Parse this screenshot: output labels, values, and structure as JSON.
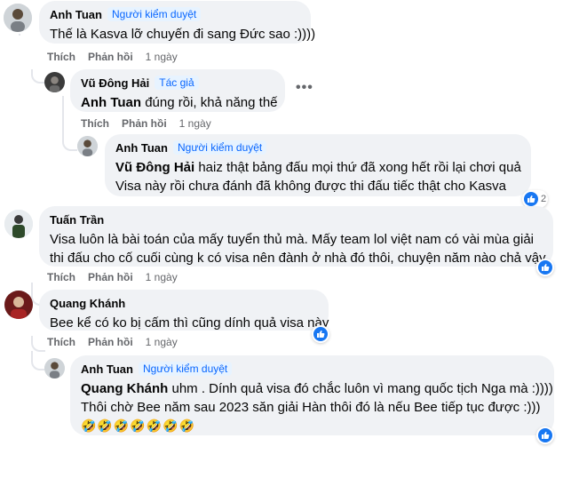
{
  "actions": {
    "like": "Thích",
    "reply": "Phản hồi"
  },
  "comments": [
    {
      "author": "Anh Tuan",
      "badge": "Người kiểm duyệt",
      "text": "Thế là Kasva lỡ chuyến đi sang Đức sao :))))",
      "time": "1 ngày"
    },
    {
      "author": "Vũ Đông Hải",
      "badge": "Tác giả",
      "mention": "Anh Tuan",
      "text": "đúng rồi, khả năng thế",
      "time": "1 ngày",
      "more": "•••"
    },
    {
      "author": "Anh Tuan",
      "badge": "Người kiểm duyệt",
      "mention": "Vũ Đông Hải",
      "line1": "haiz thật bảng đấu mọi thứ đã xong hết rồi lại chơi quả",
      "line2": "Visa này rồi chưa đánh đã không được thi đấu tiếc thật cho Kasva",
      "reaction_count": "2"
    },
    {
      "author": "Tuấn Trần",
      "line1": "Visa luôn là bài toán của mấy tuyển thủ mà. Mấy team lol việt nam có vài mùa giải",
      "line2": "thi đấu cho cố cuối cùng k có visa nên đành ở nhà đó thôi, chuyện năm nào chả vậy",
      "time": "1 ngày"
    },
    {
      "author": "Quang Khánh",
      "text": "Bee kể có ko bị cấm thì cũng dính quả visa này",
      "time": "1 ngày"
    },
    {
      "author": "Anh Tuan",
      "badge": "Người kiểm duyệt",
      "mention": "Quang Khánh",
      "line1": "uhm . Dính quả visa đó chắc luôn vì mang quốc tịch Nga mà :))))",
      "line2": "Thôi chờ Bee năm sau 2023 săn giải Hàn thôi đó là nếu Bee tiếp tục được :)))",
      "line3": "🤣🤣🤣🤣🤣🤣🤣"
    }
  ],
  "colors": {
    "bubble": "#f0f2f5",
    "badge_bg": "#e7f3ff",
    "badge_text": "#0866ff",
    "meta": "#65676b",
    "like": "#1877f2"
  }
}
